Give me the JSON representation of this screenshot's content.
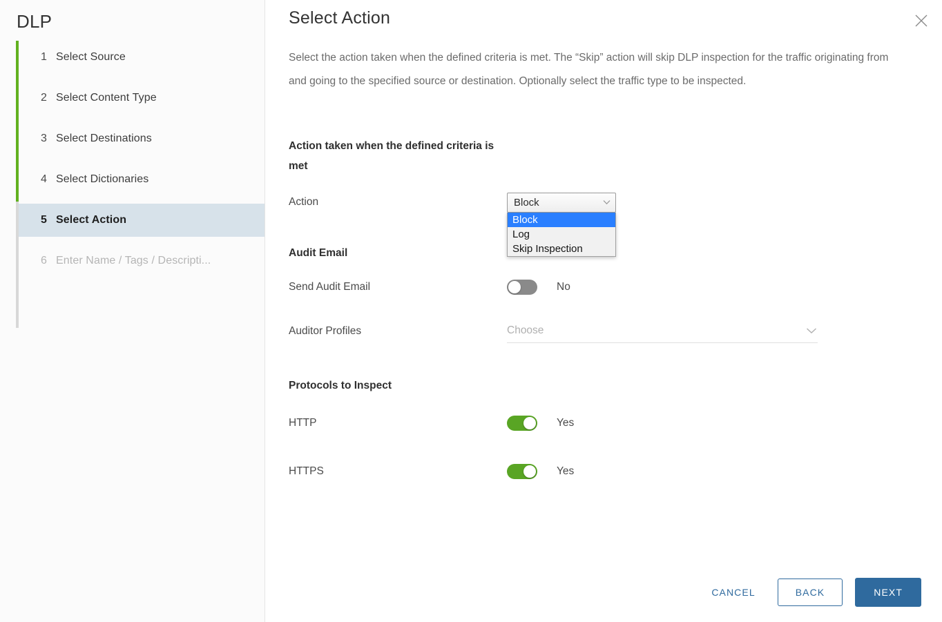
{
  "sidebar": {
    "title": "DLP",
    "steps": [
      {
        "num": "1",
        "label": "Select Source",
        "state": "done"
      },
      {
        "num": "2",
        "label": "Select Content Type",
        "state": "done"
      },
      {
        "num": "3",
        "label": "Select Destinations",
        "state": "done"
      },
      {
        "num": "4",
        "label": "Select Dictionaries",
        "state": "done"
      },
      {
        "num": "5",
        "label": "Select Action",
        "state": "active"
      },
      {
        "num": "6",
        "label": "Enter Name / Tags / Descripti...",
        "state": "disabled"
      }
    ],
    "rail_done_color": "#62b120",
    "rail_rest_color": "#d8d8d8",
    "active_bg_color": "#d7e2ea"
  },
  "panel": {
    "title": "Select Action",
    "description": "Select the action taken when the defined criteria is met. The “Skip” action will skip DLP inspection for the traffic originating from and going to the specified source or destination. Optionally select the traffic type to be inspected.",
    "close_icon": "close-icon"
  },
  "action_section": {
    "heading": "Action taken when the defined criteria is met",
    "action_label": "Action",
    "select": {
      "value": "Block",
      "open": true,
      "caret_icon": "chevron-down-icon",
      "options": [
        {
          "label": "Block",
          "selected": true
        },
        {
          "label": "Log",
          "selected": false
        },
        {
          "label": "Skip Inspection",
          "selected": false
        }
      ],
      "highlight_color": "#2a7fff"
    }
  },
  "audit_section": {
    "heading": "Audit Email",
    "send_audit_email": {
      "label": "Send Audit Email",
      "state_text": "No",
      "on": false
    },
    "auditor_profiles": {
      "label": "Auditor Profiles",
      "placeholder": "Choose",
      "caret_icon": "chevron-down-icon"
    }
  },
  "protocols_section": {
    "heading": "Protocols to Inspect",
    "items": [
      {
        "label": "HTTP",
        "state_text": "Yes",
        "on": true
      },
      {
        "label": "HTTPS",
        "state_text": "Yes",
        "on": true
      }
    ],
    "on_color": "#59a524",
    "off_color": "#8a8a8a"
  },
  "footer": {
    "cancel_label": "CANCEL",
    "back_label": "BACK",
    "next_label": "NEXT",
    "accent_color": "#2f6a9e"
  }
}
